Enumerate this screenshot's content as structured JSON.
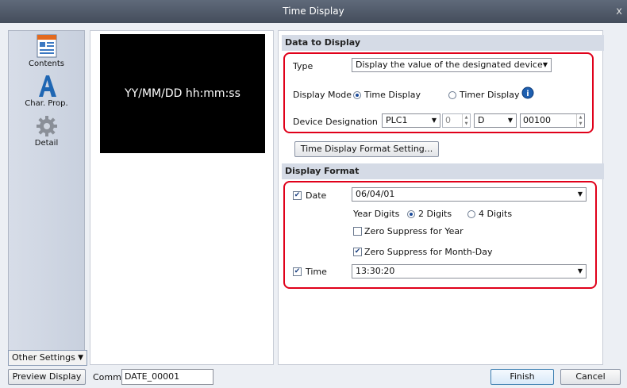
{
  "window": {
    "title": "Time Display",
    "close_label": "x"
  },
  "sidebar": {
    "items": [
      {
        "label": "Contents",
        "icon": "contents-icon"
      },
      {
        "label": "Char. Prop.",
        "icon": "char-prop-icon"
      },
      {
        "label": "Detail",
        "icon": "detail-gear-icon"
      }
    ],
    "other_settings_label": "Other Settings"
  },
  "preview": {
    "text": "YY/MM/DD hh:mm:ss"
  },
  "data_to_display": {
    "header": "Data to Display",
    "type_label": "Type",
    "type_value": "Display the value of the designated device",
    "display_mode_label": "Display Mode",
    "mode_time_label": "Time Display",
    "mode_timer_label": "Timer Display",
    "device_label": "Device Designation",
    "device_plc": "PLC1",
    "device_station": "0",
    "device_type": "D",
    "device_address": "00100",
    "format_button": "Time Display Format Setting..."
  },
  "display_format": {
    "header": "Display Format",
    "date_label": "Date",
    "date_checked": true,
    "date_value": "06/04/01",
    "year_digits_label": "Year Digits",
    "year_2_label": "2 Digits",
    "year_4_label": "4 Digits",
    "zero_year_label": "Zero Suppress for Year",
    "zero_year_checked": false,
    "zero_md_label": "Zero Suppress for Month-Day",
    "zero_md_checked": true,
    "time_label": "Time",
    "time_checked": true,
    "time_value": "13:30:20"
  },
  "footer": {
    "preview_button": "Preview Display",
    "comm_label": "Comm",
    "comm_value": "DATE_00001",
    "finish_button": "Finish",
    "cancel_button": "Cancel"
  },
  "colors": {
    "highlight": "#e0001a",
    "title_bar": "#505a69",
    "accent": "#1a4a9a"
  }
}
